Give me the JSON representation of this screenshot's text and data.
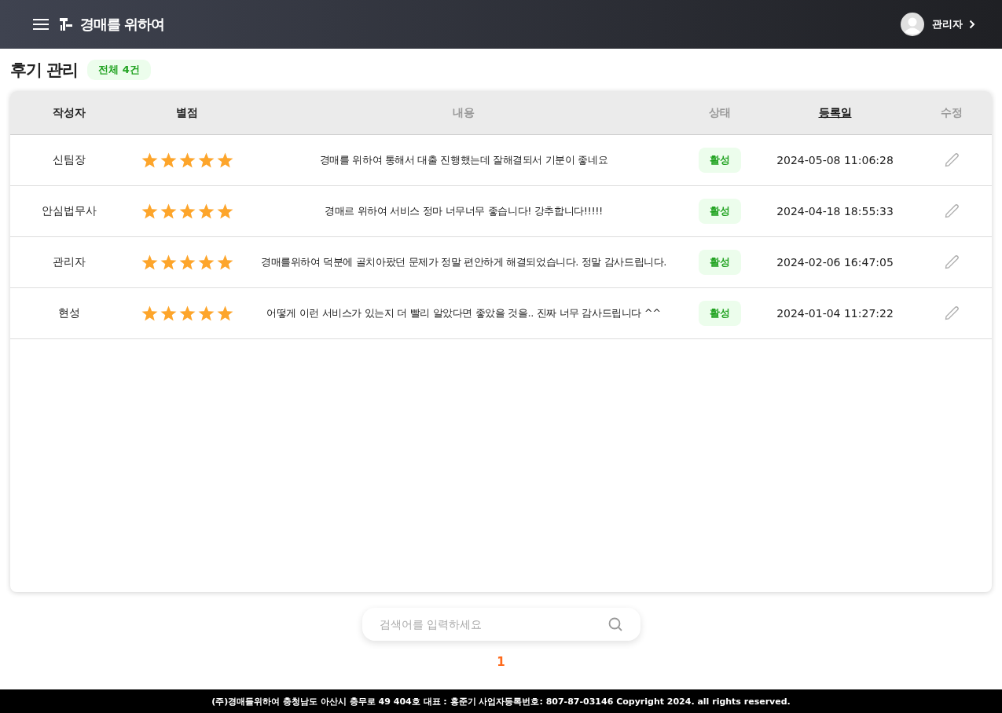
{
  "header": {
    "logo_text": "경매를 위하여",
    "user": "관리자"
  },
  "page": {
    "title": "후기 관리",
    "total_badge": "전체 4건"
  },
  "table": {
    "columns": [
      {
        "label": "작성자",
        "kind": "plain"
      },
      {
        "label": "별점",
        "kind": "plain"
      },
      {
        "label": "내용",
        "kind": "muted"
      },
      {
        "label": "상태",
        "kind": "muted"
      },
      {
        "label": "등록일",
        "kind": "sorted"
      },
      {
        "label": "수정",
        "kind": "muted"
      }
    ],
    "rows": [
      {
        "author": "신팀장",
        "stars": 5,
        "content": "경매를 위하여 통해서 대출 진행했는데 잘해결되서 기분이 좋네요",
        "status": "활성",
        "active": true,
        "date": "2024-05-08 11:06:28"
      },
      {
        "author": "안심법무사",
        "stars": 5,
        "content": "경매르 위하여 서비스 정마 너무너무 좋습니다! 강추합니다!!!!!",
        "status": "활성",
        "active": true,
        "date": "2024-04-18 18:55:33"
      },
      {
        "author": "관리자",
        "stars": 5,
        "content": "경매를위하여 덕분에 골치아팠던 문제가 정말 편안하게 해결되었습니다. 정말 감사드립니다.",
        "status": "활성",
        "active": true,
        "date": "2024-02-06 16:47:05"
      },
      {
        "author": "현성",
        "stars": 5,
        "content": "어떻게 이런 서비스가 있는지 더 빨리 알았다면 좋았을 것을.. 진짜 너무 감사드립니다 ^^",
        "status": "활성",
        "active": true,
        "date": "2024-01-04 11:27:22"
      }
    ]
  },
  "search": {
    "placeholder": "검색어를 입력하세요"
  },
  "pagination": [
    {
      "label": "1",
      "selected": true
    }
  ],
  "footer": "(주)경매들위하여 충청남도 아산시 충무로 49 404호 대표 : 홍준기 사업자등록번호: 807-87-03146 Copyright 2024. all rights reserved."
}
